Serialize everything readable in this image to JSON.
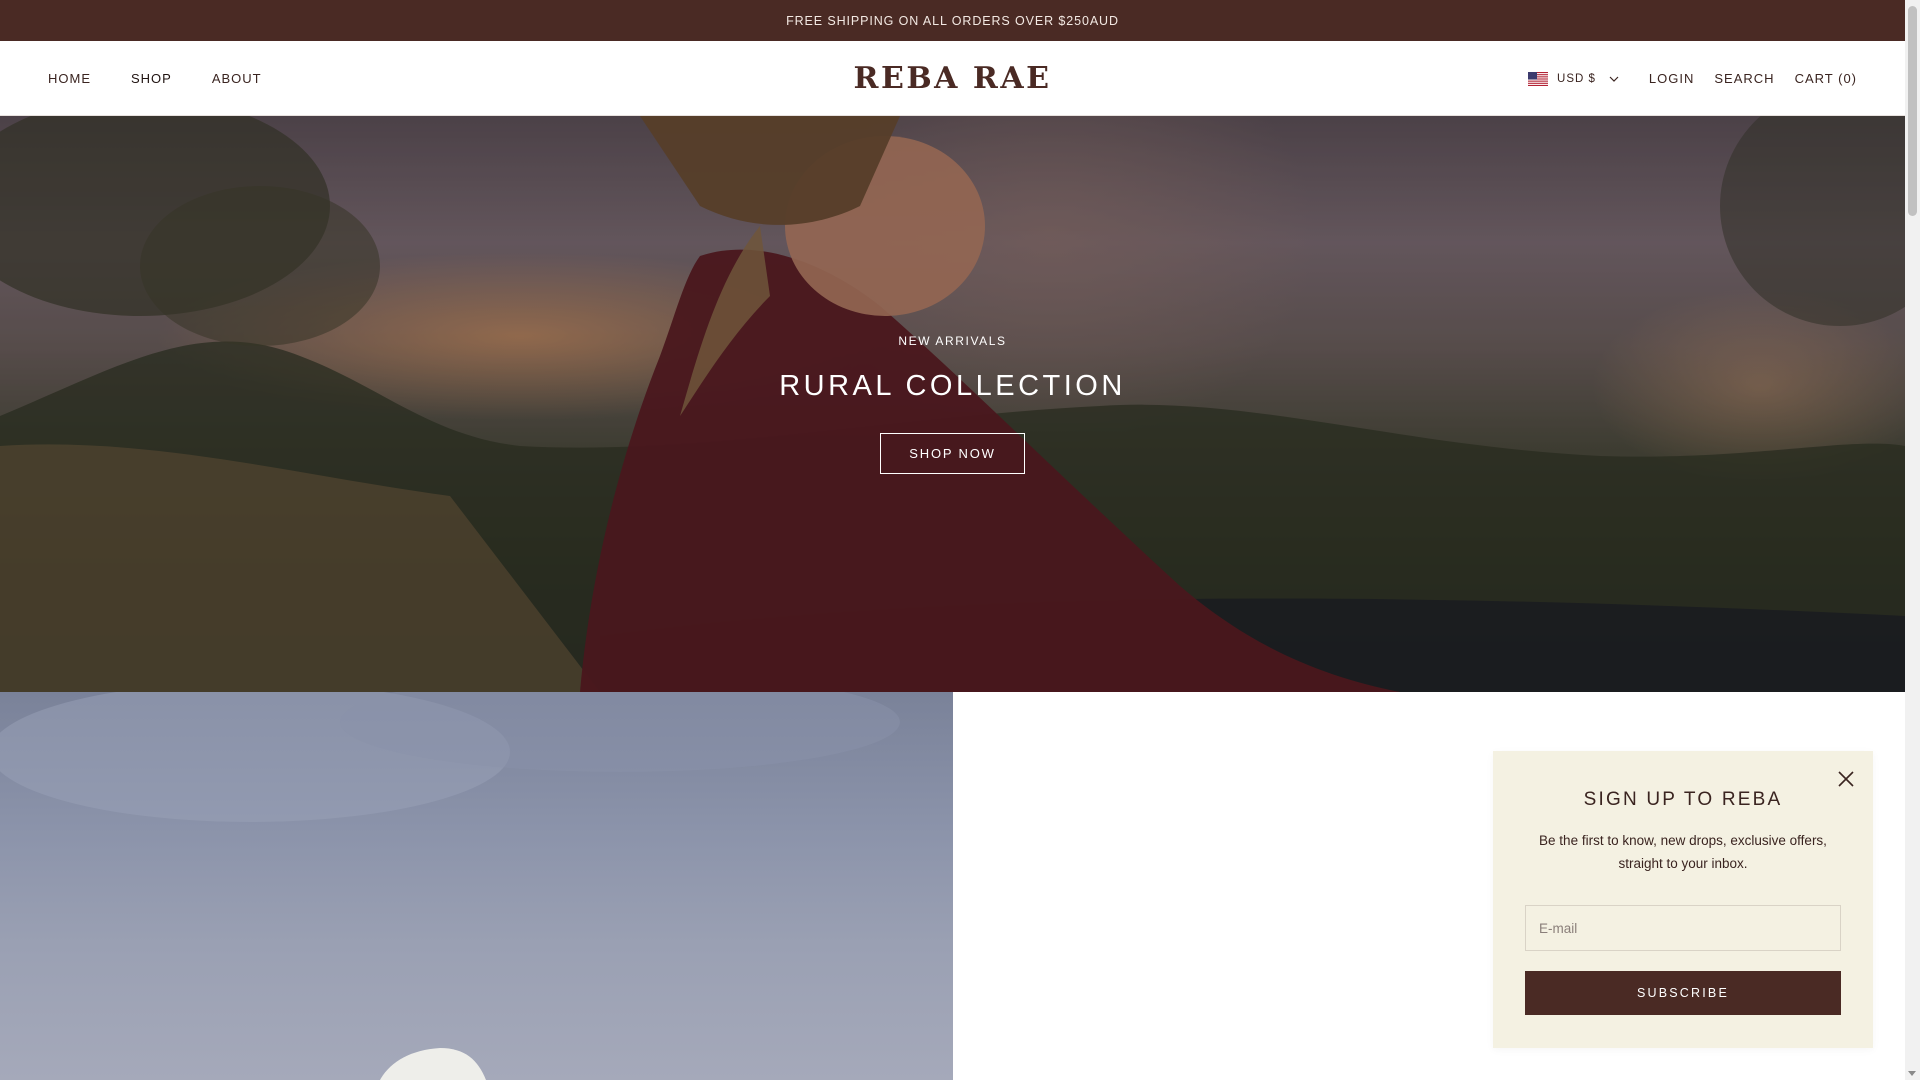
{
  "announcement": {
    "text": "FREE SHIPPING ON ALL ORDERS OVER $250AUD"
  },
  "header": {
    "nav_left": [
      "HOME",
      "SHOP",
      "ABOUT"
    ],
    "logo": "REBA RAE",
    "currency": {
      "label": "USD $",
      "flag": "us-flag-icon"
    },
    "nav_right": {
      "login": "LOGIN",
      "search": "SEARCH",
      "cart": "CART (0)"
    }
  },
  "hero": {
    "eyebrow": "NEW ARRIVALS",
    "title": "RURAL COLLECTION",
    "button": "SHOP NOW"
  },
  "popup": {
    "title": "SIGN UP TO REBA",
    "text": "Be the first to know, new drops, exclusive offers, straight to your inbox.",
    "email_placeholder": "E-mail",
    "email_value": "",
    "subscribe": "SUBSCRIBE"
  },
  "colors": {
    "brand": "#4a2a24",
    "popup_bg": "#f4f1e2",
    "shirt": "#5a1a22"
  }
}
